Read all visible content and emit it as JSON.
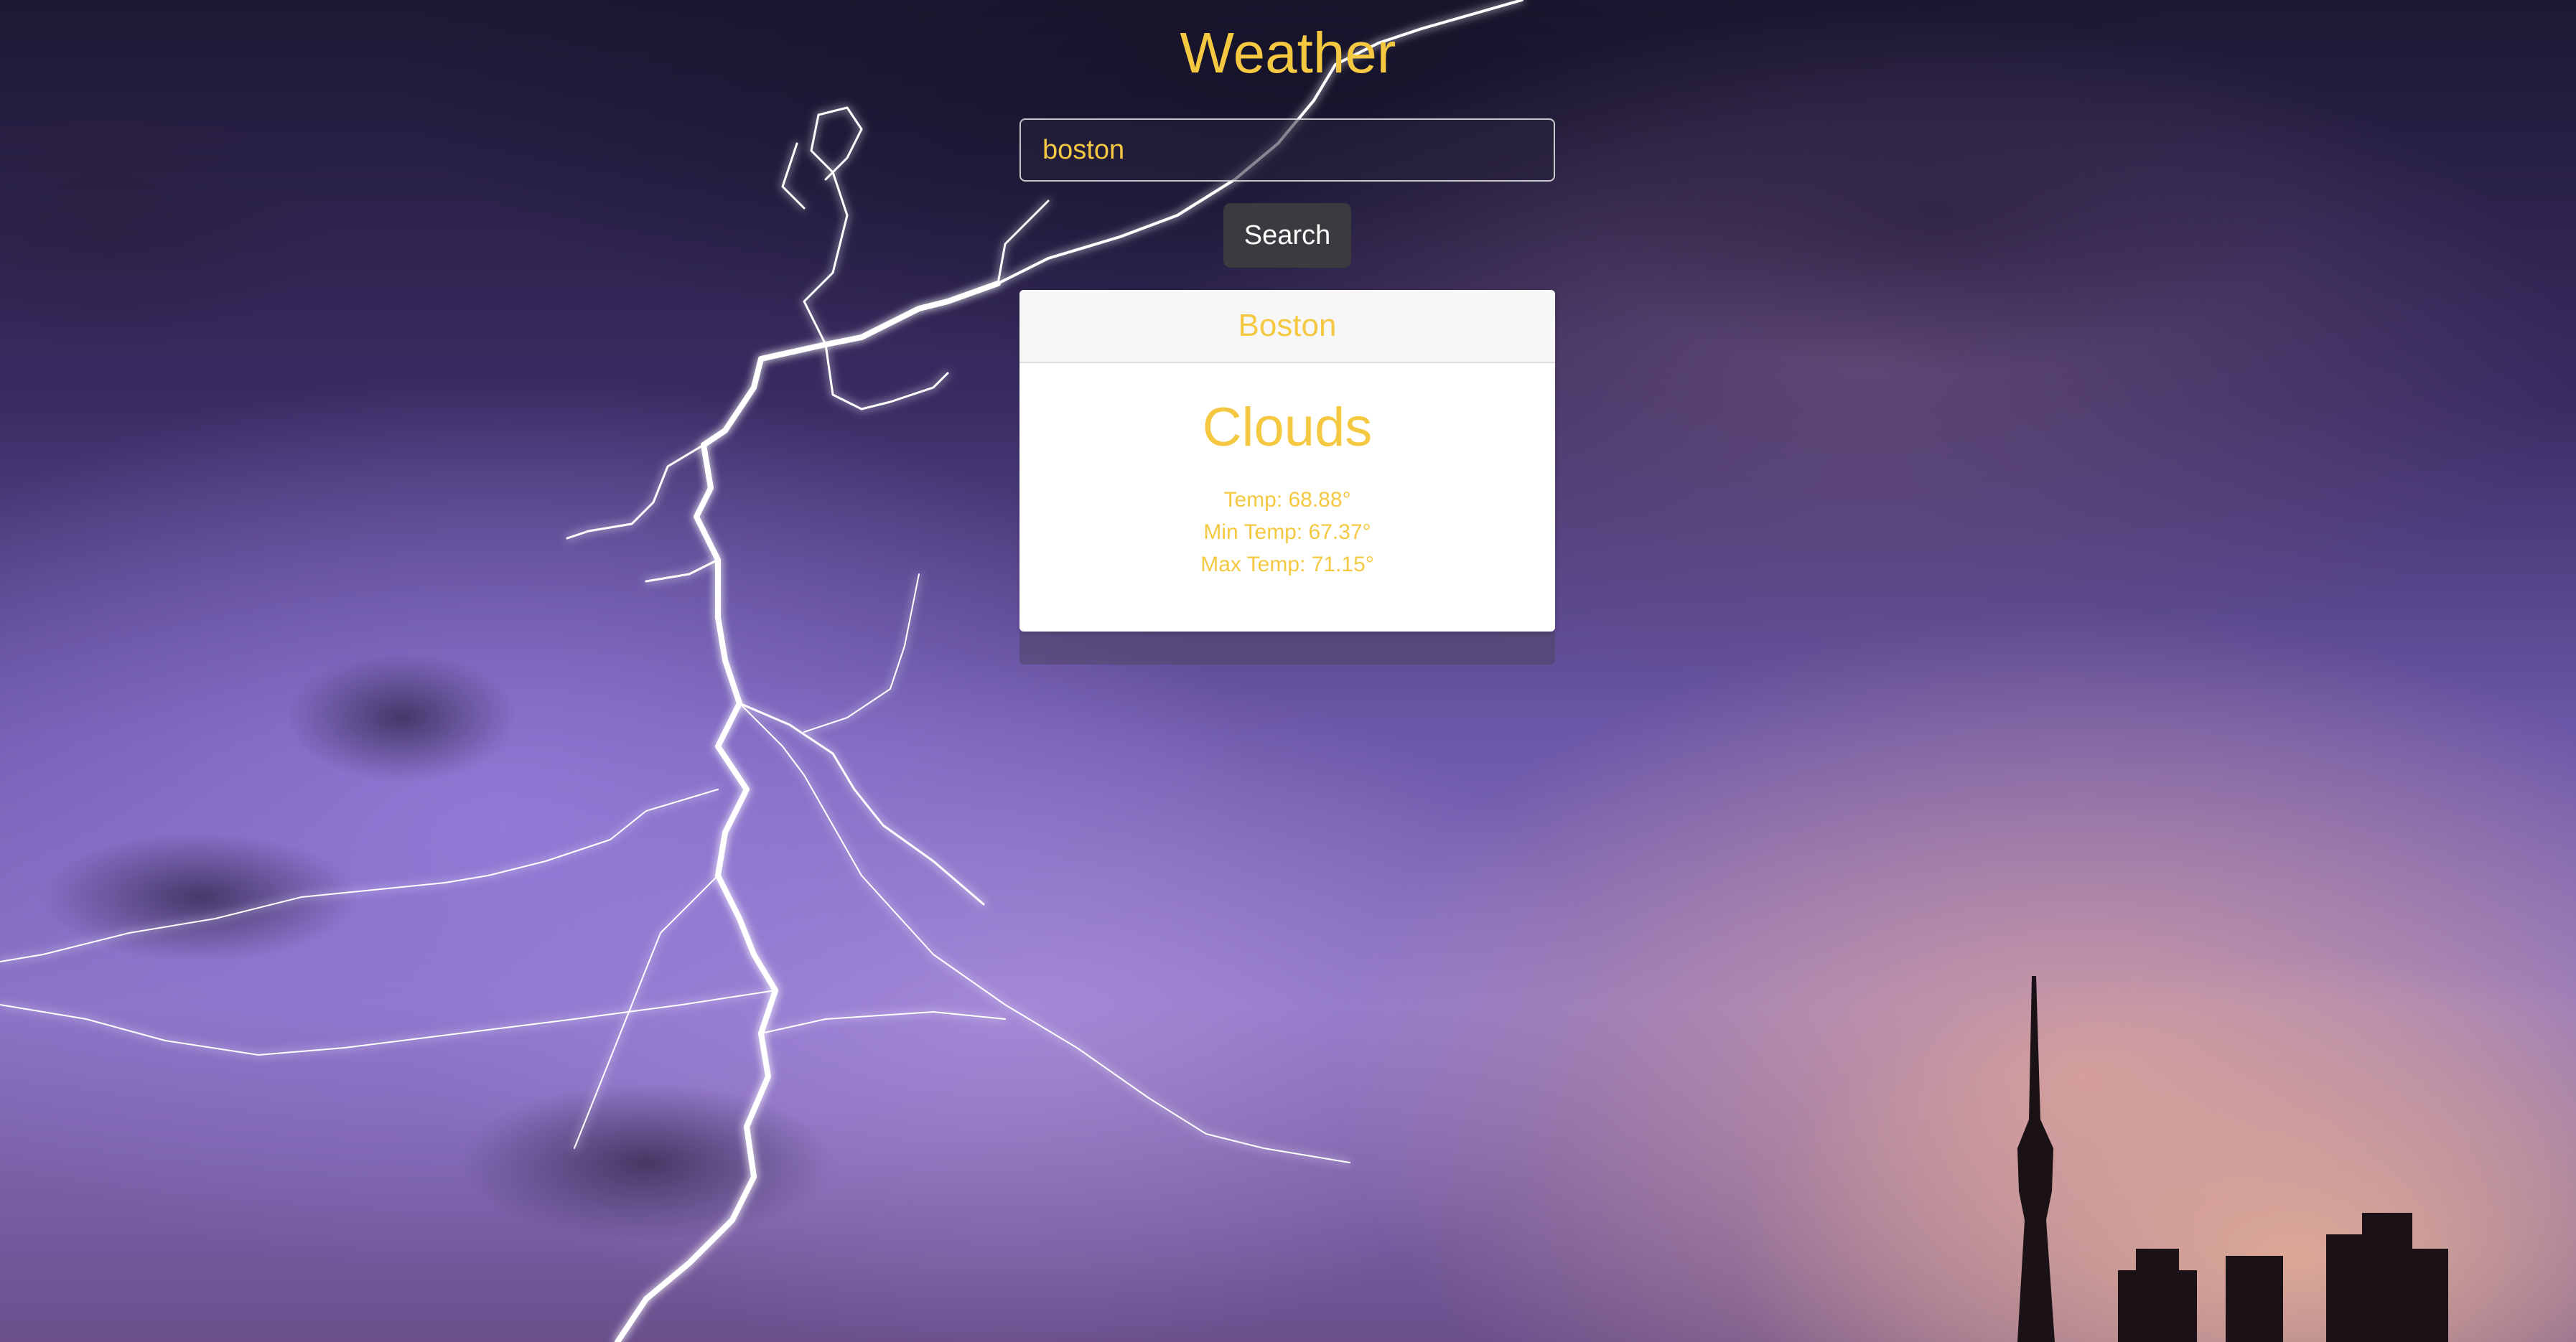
{
  "app": {
    "title": "Weather"
  },
  "search": {
    "value": "boston",
    "button_label": "Search"
  },
  "result": {
    "city": "Boston",
    "condition": "Clouds",
    "temp": "Temp: 68.88°",
    "min_temp": "Min Temp: 67.37°",
    "max_temp": "Max Temp: 71.15°"
  },
  "colors": {
    "accent": "#f5c842",
    "button_bg": "#3a3b3f",
    "card_bg": "#ffffff",
    "card_header_bg": "#f7f7f7"
  },
  "background": {
    "description_icon": "lightning-storm-image"
  }
}
